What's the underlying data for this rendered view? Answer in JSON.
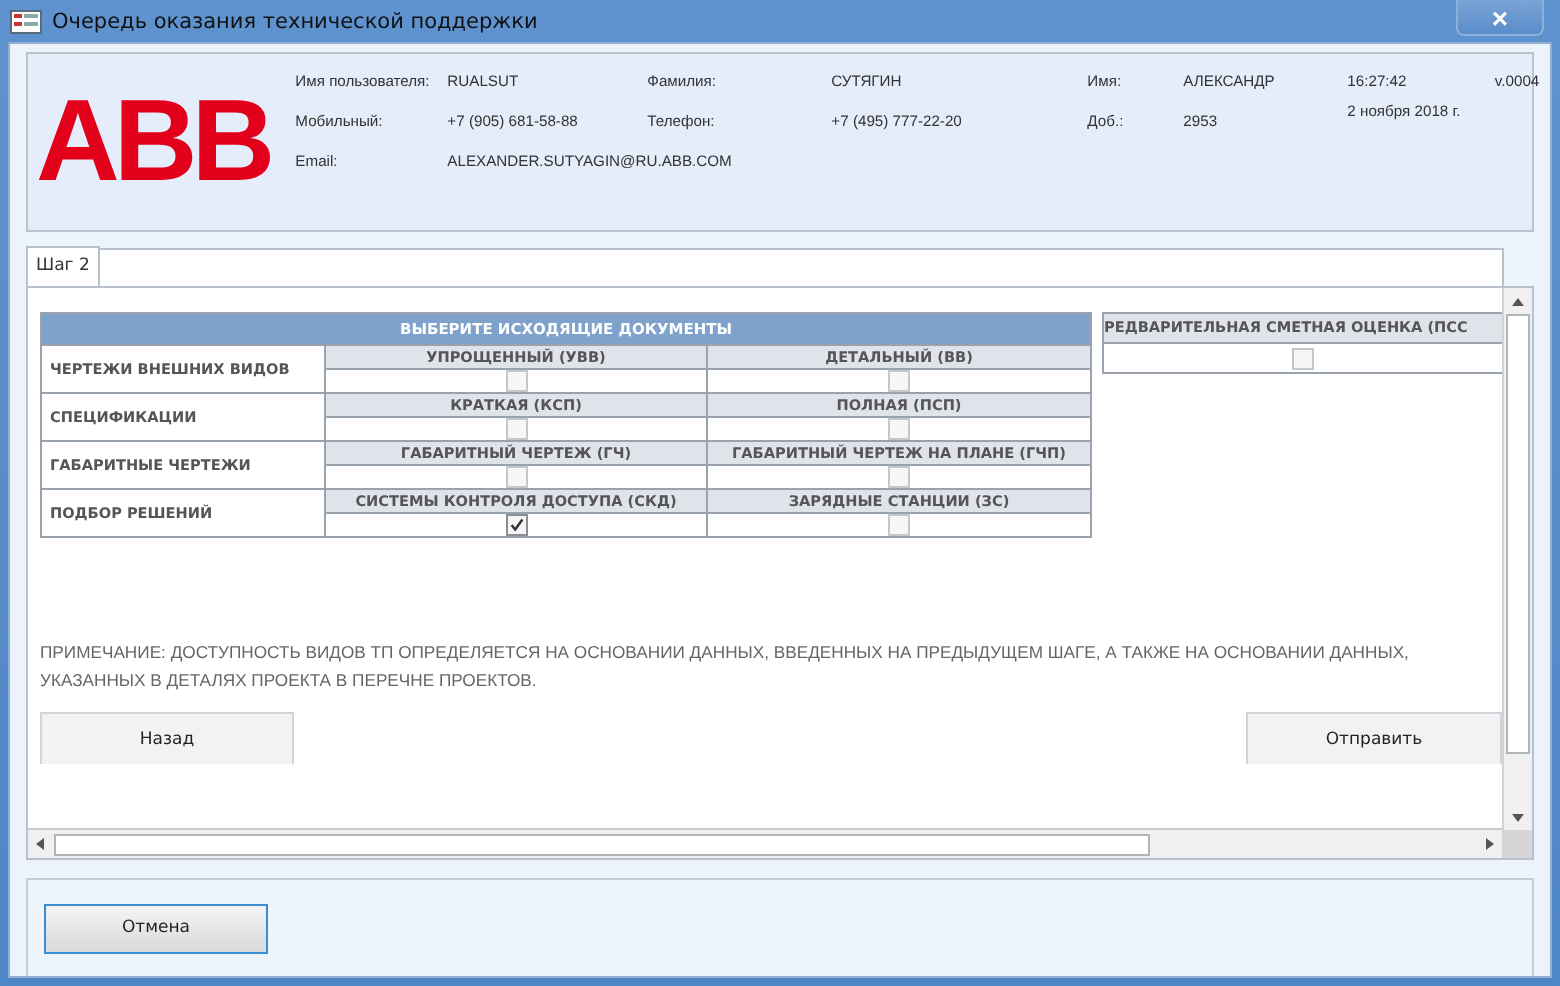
{
  "window": {
    "title": "Очередь оказания технической поддержки",
    "close": "×"
  },
  "header": {
    "logo": "ABB",
    "fields": [
      {
        "label": "Имя пользователя:",
        "value": "RUALSUT"
      },
      {
        "label": "Фамилия:",
        "value": "СУТЯГИН"
      },
      {
        "label": "Имя:",
        "value": "АЛЕКСАНДР"
      },
      {
        "label": "Мобильный:",
        "value": "+7 (905) 681-58-88"
      },
      {
        "label": "Телефон:",
        "value": "+7 (495) 777-22-20"
      },
      {
        "label": "Доб.:",
        "value": "2953"
      },
      {
        "label": "Email:",
        "value": "ALEXANDER.SUTYAGIN@RU.ABB.COM"
      }
    ],
    "time": "16:27:42",
    "version": "v.0004",
    "date": "2 ноября 2018 г."
  },
  "tabs": [
    {
      "label": "Шаг 2",
      "selected": true
    }
  ],
  "table": {
    "title": "ВЫБЕРИТЕ ИСХОДЯЩИЕ ДОКУМЕНТЫ",
    "rows": [
      {
        "label": "ЧЕРТЕЖИ ВНЕШНИХ ВИДОВ",
        "options": [
          {
            "label": "УПРОЩЕННЫЙ (УВВ)",
            "checked": false
          },
          {
            "label": "ДЕТАЛЬНЫЙ (ВВ)",
            "checked": false
          }
        ]
      },
      {
        "label": "СПЕЦИФИКАЦИИ",
        "options": [
          {
            "label": "КРАТКАЯ (КСП)",
            "checked": false
          },
          {
            "label": "ПОЛНАЯ (ПСП)",
            "checked": false
          }
        ]
      },
      {
        "label": "ГАБАРИТНЫЕ ЧЕРТЕЖИ",
        "options": [
          {
            "label": "ГАБАРИТНЫЙ ЧЕРТЕЖ (ГЧ)",
            "checked": false
          },
          {
            "label": "ГАБАРИТНЫЙ ЧЕРТЕЖ НА ПЛАНЕ (ГЧП)",
            "checked": false
          }
        ]
      },
      {
        "label": "ПОДБОР РЕШЕНИЙ",
        "options": [
          {
            "label": "СИСТЕМЫ КОНТРОЛЯ ДОСТУПА (СКД)",
            "checked": true
          },
          {
            "label": "ЗАРЯДНЫЕ СТАНЦИИ (ЗС)",
            "checked": false
          }
        ]
      }
    ]
  },
  "side_option": {
    "label": "РЕДВАРИТЕЛЬНАЯ СМЕТНАЯ ОЦЕНКА (ПСС",
    "checked": false
  },
  "note": "ПРИМЕЧАНИЕ: ДОСТУПНОСТЬ ВИДОВ ТП ОПРЕДЕЛЯЕТСЯ НА ОСНОВАНИИ ДАННЫХ, ВВЕДЕННЫХ НА ПРЕДЫДУЩЕМ ШАГЕ, А ТАКЖЕ НА ОСНОВАНИИ ДАННЫХ, УКАЗАННЫХ В ДЕТАЛЯХ ПРОЕКТА В ПЕРЕЧНЕ ПРОЕКТОВ.",
  "buttons": {
    "back": "Назад",
    "send": "Отправить",
    "cancel": "Отмена"
  }
}
